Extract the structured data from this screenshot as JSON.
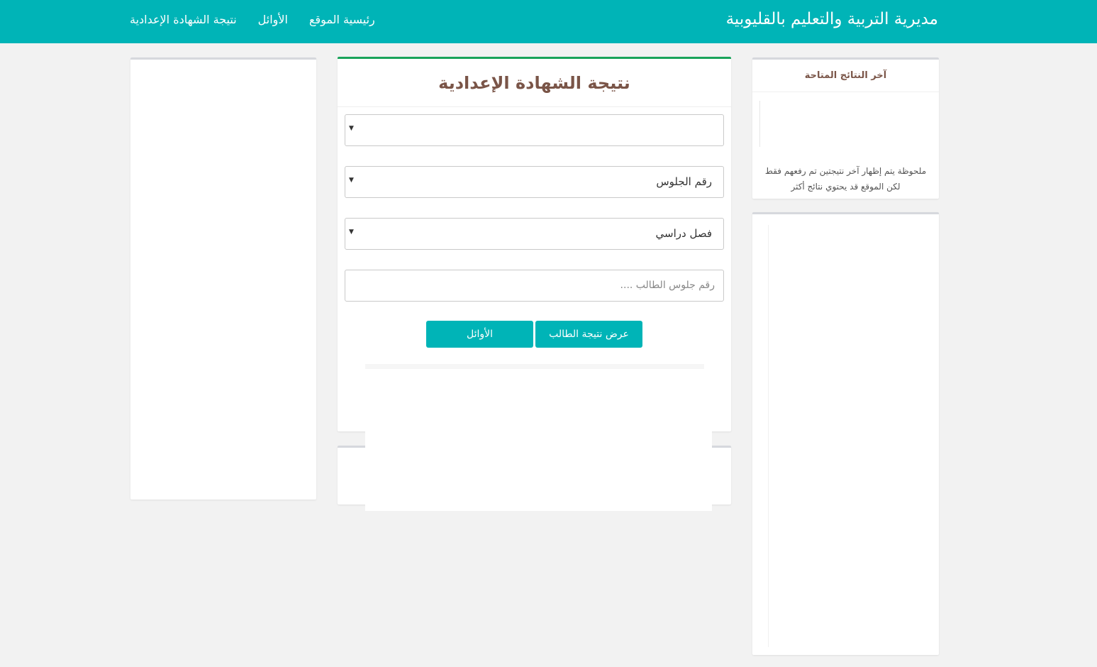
{
  "header": {
    "site_title": "مديرية التربية والتعليم بالقليوبية",
    "nav": [
      {
        "label": "نتيجة الشهادة الإعدادية"
      },
      {
        "label": "الأوائل"
      },
      {
        "label": "رئيسية الموقع"
      }
    ],
    "colors": {
      "bar": "#00b4b7",
      "title_brown": "#7a5548",
      "accent_green": "#1aa35a"
    }
  },
  "main": {
    "title": "نتيجة الشهادة الإعدادية",
    "select_1": {
      "value": ""
    },
    "select_2": {
      "value": "رقم الجلوس"
    },
    "select_3": {
      "value": "فصل دراسي"
    },
    "seat_input": {
      "placeholder": "رقم جلوس الطالب ...."
    },
    "show_button": "عرض نتيجة الطالب",
    "top_button": "الأوائل"
  },
  "sidebar_right": {
    "latest_title": "آخر النتائج المتاحة",
    "note": "ملحوظة يتم إظهار آخر نتيجتين تم رفعهم فقط لكن الموقع قد يحتوي نتائج أكثر"
  }
}
